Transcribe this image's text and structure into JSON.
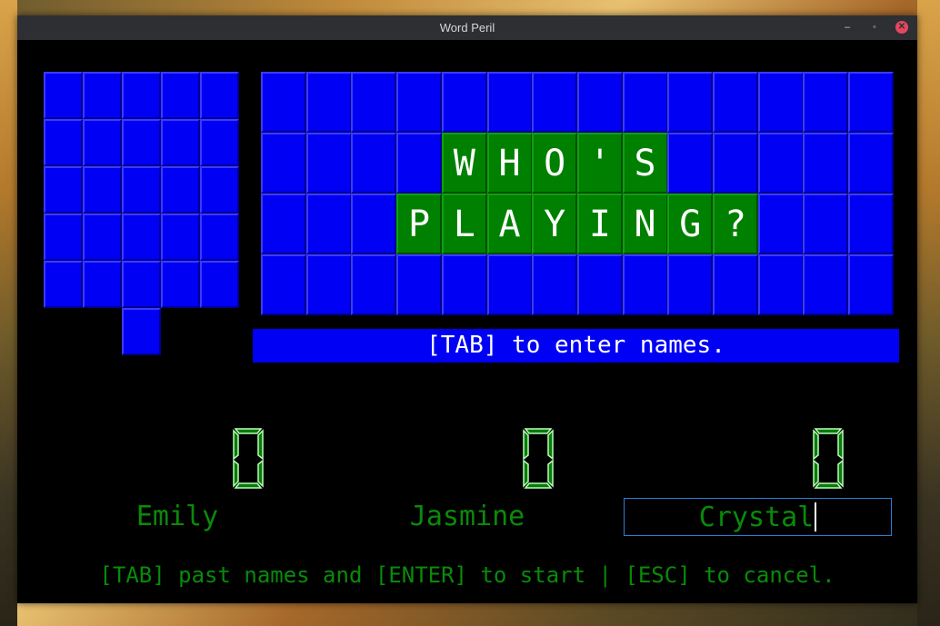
{
  "window": {
    "title": "Word Peril",
    "buttons": {
      "minimize": "–",
      "maximize": "◦",
      "close": "✕"
    }
  },
  "board": {
    "row1": "WHO'S",
    "row2": "PLAYING?",
    "lit_color": "#008000",
    "tile_color": "#0000f5"
  },
  "prompt": "[TAB] to enter names.",
  "players": [
    {
      "name": "Emily",
      "score": "0",
      "active": false
    },
    {
      "name": "Jasmine",
      "score": "0",
      "active": false
    },
    {
      "name": "Crystal",
      "score": "0",
      "active": true
    }
  ],
  "footer": "[TAB] past names and [ENTER] to start | [ESC] to cancel."
}
